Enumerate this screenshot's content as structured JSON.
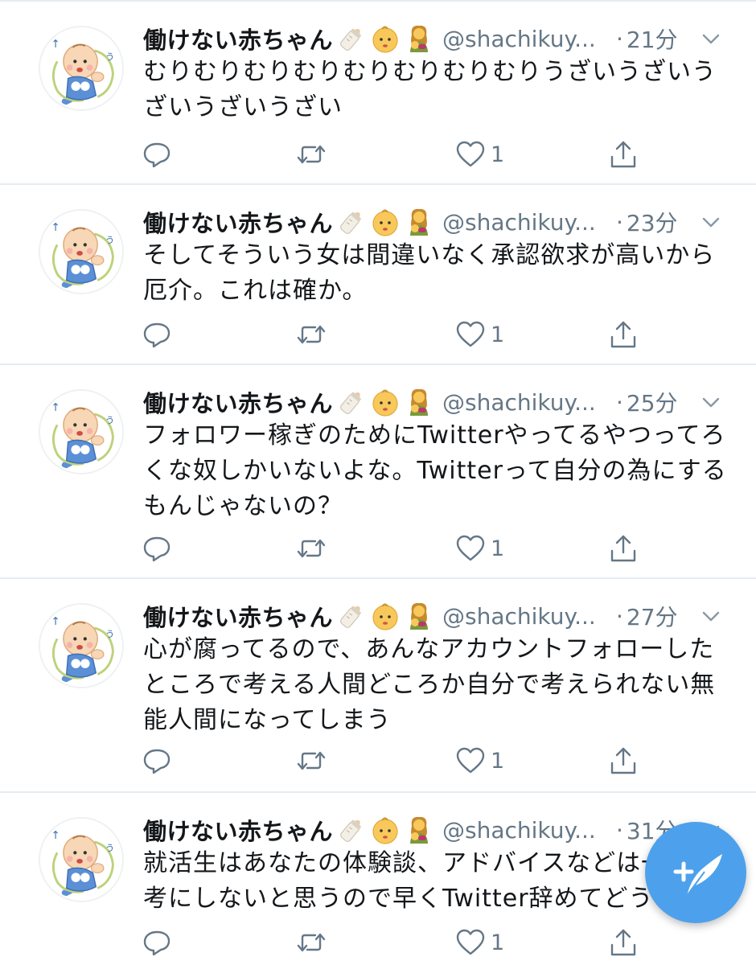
{
  "colors": {
    "text": "#14171a",
    "meta": "#657786",
    "divider": "#e6ecf0",
    "accent": "#4da1ec"
  },
  "tweets": [
    {
      "name": "働けない赤ちゃん",
      "emojis": [
        "baby-bottle-icon",
        "baby-face-icon",
        "breastfeeding-icon"
      ],
      "handle": "@shachikuy...",
      "dot": "·",
      "time": "21分",
      "text": "むりむりむりむりむりむりむりむりうざいうざいうざいうざいうざい",
      "reply_count": "",
      "retweet_count": "",
      "like_count": "1"
    },
    {
      "name": "働けない赤ちゃん",
      "emojis": [
        "baby-bottle-icon",
        "baby-face-icon",
        "breastfeeding-icon"
      ],
      "handle": "@shachikuy...",
      "dot": "·",
      "time": "23分",
      "text": "そしてそういう女は間違いなく承認欲求が高いから厄介。これは確か。",
      "reply_count": "",
      "retweet_count": "",
      "like_count": "1"
    },
    {
      "name": "働けない赤ちゃん",
      "emojis": [
        "baby-bottle-icon",
        "baby-face-icon",
        "breastfeeding-icon"
      ],
      "handle": "@shachikuy...",
      "dot": "·",
      "time": "25分",
      "text": "フォロワー稼ぎのためにTwitterやってるやつってろくな奴しかいないよな。Twitterって自分の為にするもんじゃないの？",
      "reply_count": "",
      "retweet_count": "",
      "like_count": "1"
    },
    {
      "name": "働けない赤ちゃん",
      "emojis": [
        "baby-bottle-icon",
        "baby-face-icon",
        "breastfeeding-icon"
      ],
      "handle": "@shachikuy...",
      "dot": "·",
      "time": "27分",
      "text": "心が腐ってるので、あんなアカウントフォローしたところで考える人間どころか自分で考えられない無能人間になってしまう",
      "reply_count": "",
      "retweet_count": "",
      "like_count": "1"
    },
    {
      "name": "働けない赤ちゃん",
      "emojis": [
        "baby-bottle-icon",
        "baby-face-icon",
        "breastfeeding-icon"
      ],
      "handle": "@shachikuy...",
      "dot": "·",
      "time": "31分",
      "text": "就活生はあなたの体験談、アドバイスなどは一切参考にしないと思うので早くTwitter辞めてどうぞ",
      "reply_count": "",
      "retweet_count": "",
      "like_count": "1"
    }
  ],
  "fab": {
    "icon": "compose-tweet-icon"
  }
}
